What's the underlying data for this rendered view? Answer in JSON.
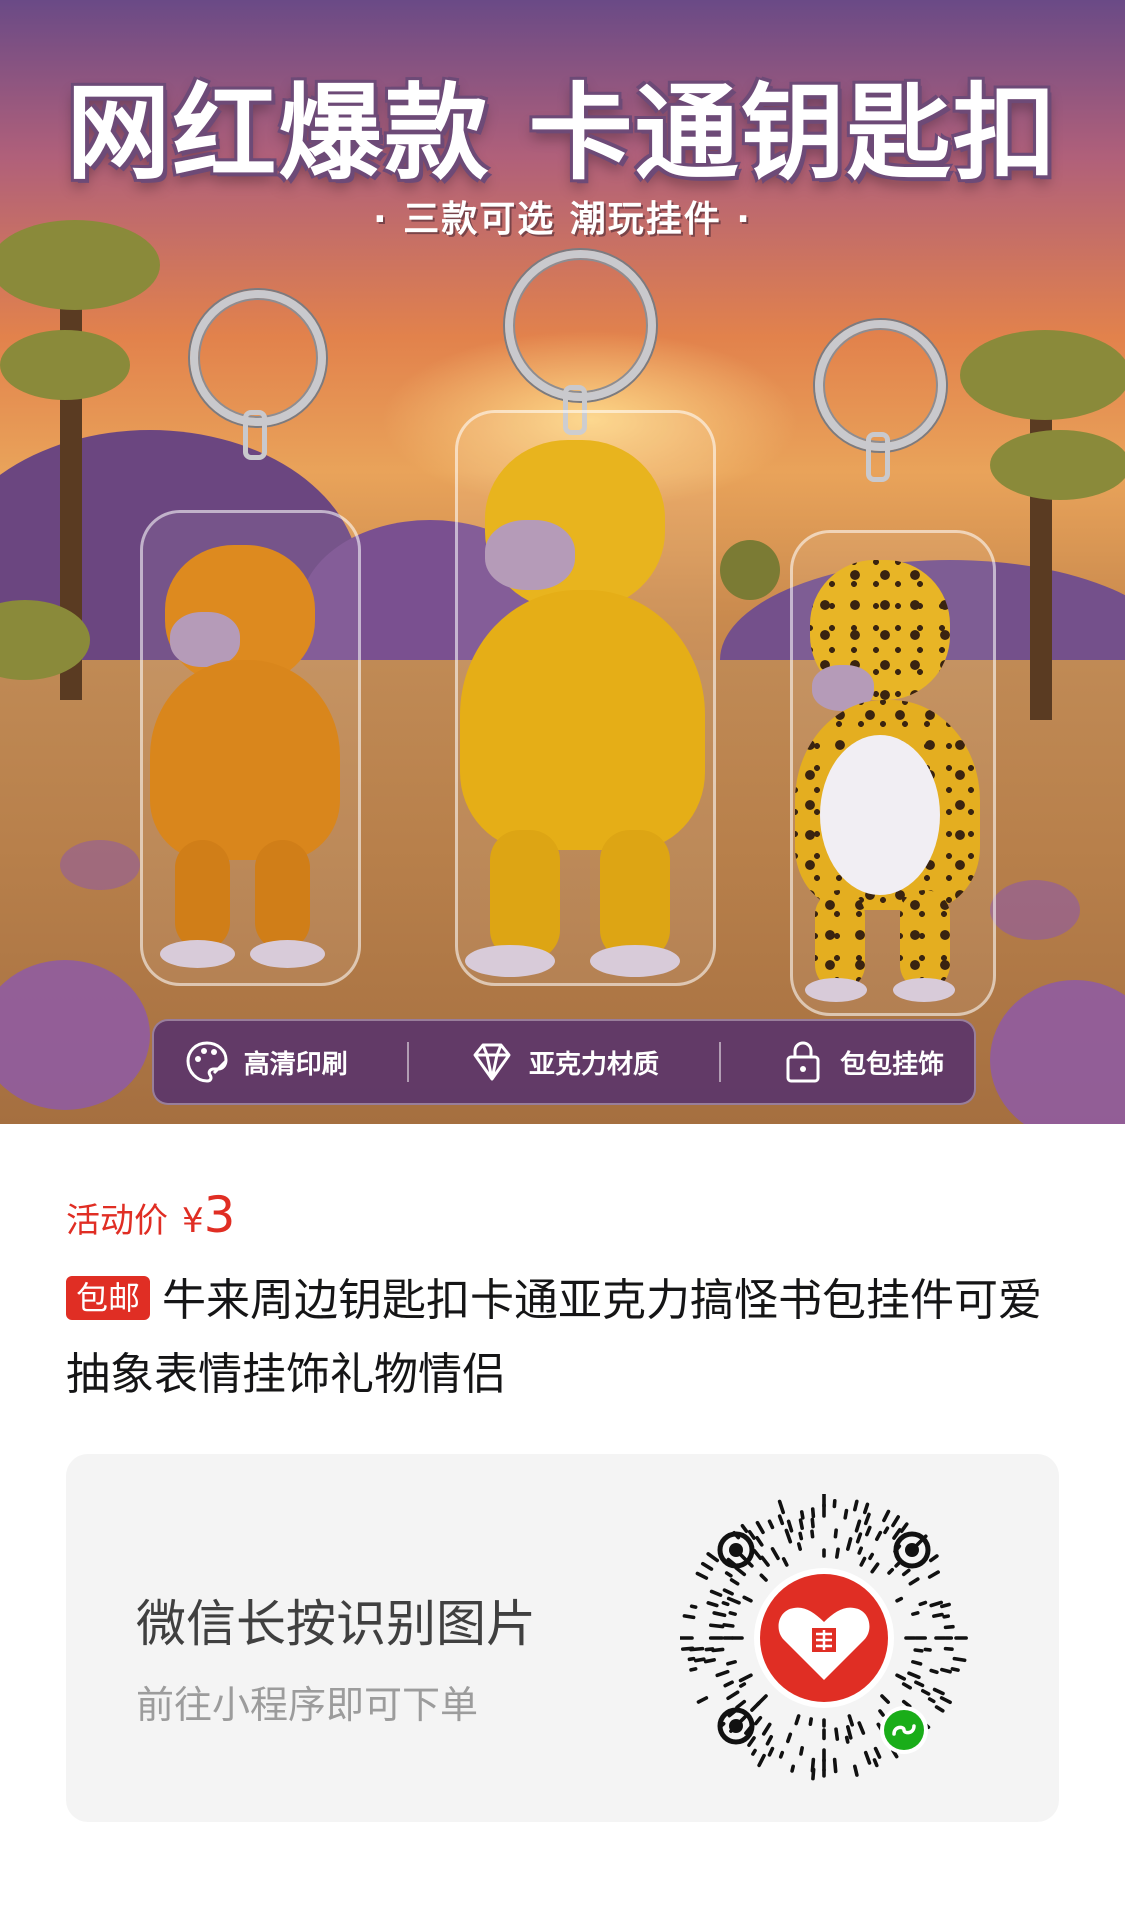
{
  "banner": {
    "headline": "网红爆款 卡通钥匙扣",
    "subline": "· 三款可选 潮玩挂件 ·",
    "features": [
      {
        "icon": "palette-icon",
        "label": "高清印刷"
      },
      {
        "icon": "diamond-icon",
        "label": "亚克力材质"
      },
      {
        "icon": "bag-lock-icon",
        "label": "包包挂饰"
      }
    ]
  },
  "price": {
    "label": "活动价",
    "currency": "¥",
    "value": "3",
    "color": "#e02e24"
  },
  "product": {
    "badge": "包邮",
    "title": "牛来周边钥匙扣卡通亚克力搞怪书包挂件可爱抽象表情挂饰礼物情侣"
  },
  "miniprogram": {
    "title": "微信长按识别图片",
    "subtitle": "前往小程序即可下单",
    "qr_icon": "pinduoduo-logo",
    "badge_icon": "wechat-miniprogram-icon"
  }
}
